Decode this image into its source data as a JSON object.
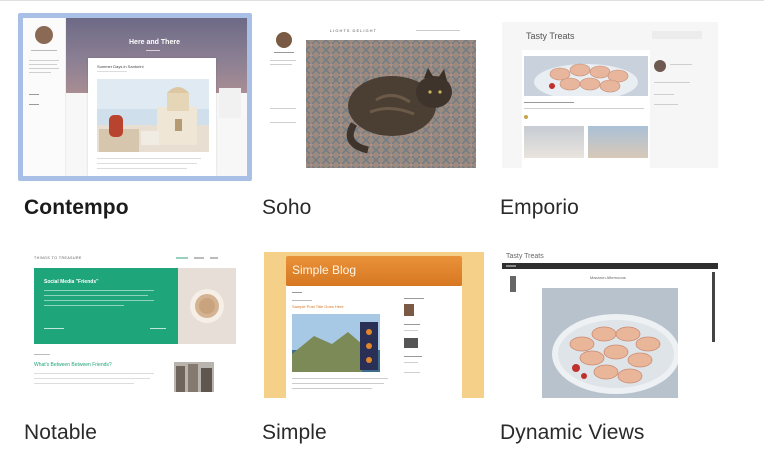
{
  "themes": [
    {
      "id": "contempo",
      "label": "Contempo",
      "selected": true,
      "preview": {
        "hero_title": "Here and There",
        "post_title": "Summer Days in Santorini"
      }
    },
    {
      "id": "soho",
      "label": "Soho",
      "selected": false,
      "preview": {
        "header_title": "LIGHTS DELIGHT"
      }
    },
    {
      "id": "emporio",
      "label": "Emporio",
      "selected": false,
      "preview": {
        "site_title": "Tasty Treats"
      }
    },
    {
      "id": "notable",
      "label": "Notable",
      "selected": false,
      "preview": {
        "site_title": "THINGS TO TREASURE",
        "feature_title": "Social Media \"Friends\"",
        "post_title": "What's Between Between Friends?"
      }
    },
    {
      "id": "simple",
      "label": "Simple",
      "selected": false,
      "preview": {
        "site_title": "Simple Blog",
        "post_title": "Sample Post Title Goes Here"
      }
    },
    {
      "id": "dynamic-views",
      "label": "Dynamic Views",
      "selected": false,
      "preview": {
        "site_title": "Tasty Treats",
        "post_title": "Macaron Afternoons"
      }
    }
  ],
  "colors": {
    "selection_border": "#a9c0e6",
    "notable_green": "#1fa57a",
    "simple_orange": "#e2862a"
  }
}
